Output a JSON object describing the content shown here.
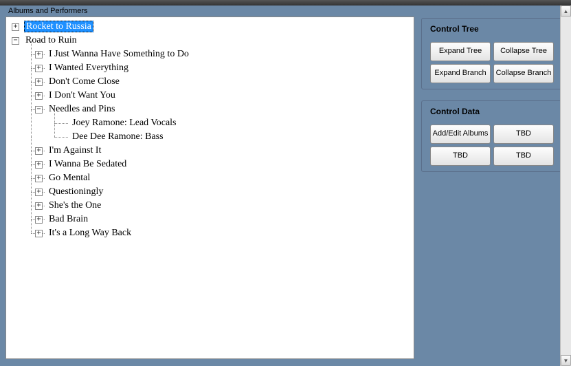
{
  "panel_title": "Albums and Performers",
  "tree": {
    "albums": [
      {
        "label": "Rocket to Russia",
        "expanded": false,
        "selected": true,
        "tracks": []
      },
      {
        "label": "Road to Ruin",
        "expanded": true,
        "selected": false,
        "tracks": [
          {
            "label": "I Just Wanna Have Something to Do",
            "expanded": false,
            "performers": []
          },
          {
            "label": "I Wanted Everything",
            "expanded": false,
            "performers": []
          },
          {
            "label": "Don't Come Close",
            "expanded": false,
            "performers": []
          },
          {
            "label": "I Don't Want You",
            "expanded": false,
            "performers": []
          },
          {
            "label": "Needles and Pins",
            "expanded": true,
            "performers": [
              {
                "label": "Joey Ramone: Lead Vocals"
              },
              {
                "label": "Dee Dee Ramone: Bass"
              }
            ]
          },
          {
            "label": "I'm Against It",
            "expanded": false,
            "performers": []
          },
          {
            "label": "I Wanna Be Sedated",
            "expanded": false,
            "performers": []
          },
          {
            "label": "Go Mental",
            "expanded": false,
            "performers": []
          },
          {
            "label": "Questioningly",
            "expanded": false,
            "performers": []
          },
          {
            "label": "She's the One",
            "expanded": false,
            "performers": []
          },
          {
            "label": "Bad Brain",
            "expanded": false,
            "performers": []
          },
          {
            "label": "It's a Long Way Back",
            "expanded": false,
            "performers": []
          }
        ]
      }
    ]
  },
  "groups": {
    "control_tree": {
      "title": "Control Tree",
      "buttons": {
        "expand_tree": "Expand Tree",
        "collapse_tree": "Collapse Tree",
        "expand_branch": "Expand Branch",
        "collapse_branch": "Collapse Branch"
      }
    },
    "control_data": {
      "title": "Control Data",
      "buttons": {
        "add_edit_albums": "Add/Edit Albums",
        "tbd1": "TBD",
        "tbd2": "TBD",
        "tbd3": "TBD"
      }
    }
  },
  "glyphs": {
    "plus": "+",
    "minus": "−",
    "up": "▲",
    "down": "▼"
  }
}
